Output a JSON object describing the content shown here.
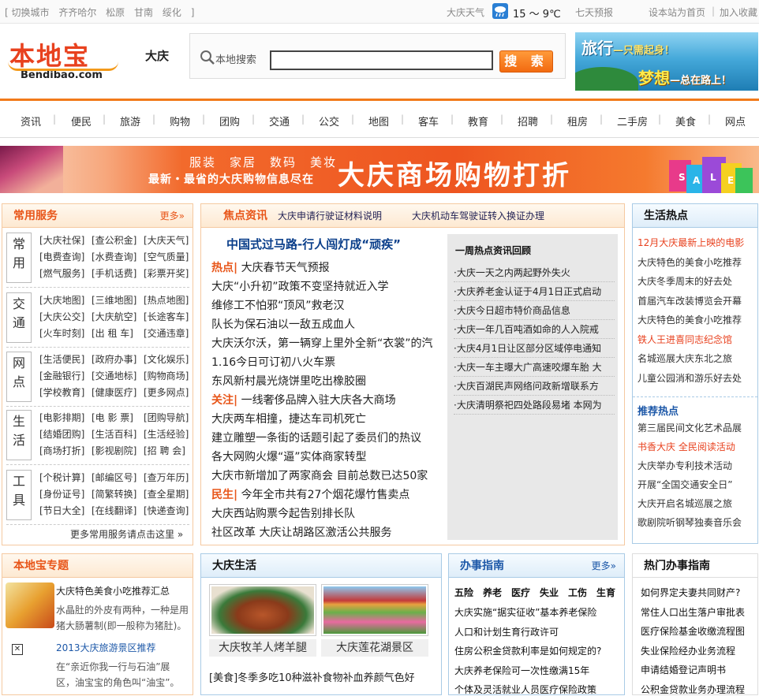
{
  "topbar": {
    "switch_city": "[ 切换城市",
    "cities": [
      "齐齐哈尔",
      "松原",
      "甘南",
      "绥化",
      "]"
    ],
    "weather_label": "大庆天气",
    "temp": "15 ～ 9℃",
    "forecast": "七天预报",
    "homepage": "设本站为首页",
    "sep": "|",
    "favorite": "加入收藏"
  },
  "header": {
    "logo_cn": "本地宝",
    "logo_en": "Bendibao.com",
    "city": "大庆",
    "search_label": "本地搜索",
    "search_value": "",
    "search_btn": "搜 索",
    "ad_line1": "旅行",
    "ad_line1b": "—只需起身！",
    "ad_line2": "梦想",
    "ad_line2b": "—总在路上！"
  },
  "nav": [
    "资讯",
    "便民",
    "旅游",
    "购物",
    "团购",
    "交通",
    "公交",
    "地图",
    "客车",
    "教育",
    "招聘",
    "租房",
    "二手房",
    "美食",
    "网点"
  ],
  "banner": {
    "line1": "服装　家居　数码　美妆",
    "line2": "最新・最省的大庆购物信息尽在",
    "title": "大庆商场购物打折"
  },
  "services": {
    "title": "常用服务",
    "more": "更多»",
    "groups": [
      {
        "cat": "常用",
        "links": [
          "[大庆社保]",
          "[查公积金]",
          "[大庆天气]",
          "[电费查询]",
          "[水费查询]",
          "[空气质量]",
          "[燃气服务]",
          "[手机话费]",
          "[彩票开奖]"
        ]
      },
      {
        "cat": "交通",
        "links": [
          "[大庆地图]",
          "[三维地图]",
          "[热点地图]",
          "[大庆公交]",
          "[大庆航空]",
          "[长途客车]",
          "[火车时刻]",
          "[出 租 车]",
          "[交通违章]"
        ]
      },
      {
        "cat": "网点",
        "links": [
          "[生活便民]",
          "[政府办事]",
          "[文化娱乐]",
          "[金融银行]",
          "[交通地标]",
          "[购物商场]",
          "[学校教育]",
          "[健康医疗]",
          "[更多网点]"
        ]
      },
      {
        "cat": "生活",
        "links": [
          "[电影排期]",
          "[电 影 票]",
          "[团购导航]",
          "[结婚团购]",
          "[生活百科]",
          "[生活经验]",
          "[商场打折]",
          "[影视剧院]",
          "[招 聘 会]"
        ]
      },
      {
        "cat": "工具",
        "links": [
          "[个税计算]",
          "[邮编区号]",
          "[查万年历]",
          "[身份证号]",
          "[简繁转换]",
          "[查全星期]",
          "[节日大全]",
          "[在线翻译]",
          "[快递查询]"
        ]
      }
    ],
    "footer": "更多常用服务请点击这里 »"
  },
  "focus": {
    "title": "焦点资讯",
    "headlines": [
      "大庆申请行驶证材料说明",
      "大庆机动车驾驶证转入换证办理"
    ],
    "top": "中国式过马路-行人闯灯成“顽疾”",
    "news": [
      {
        "tag": "热点|",
        "text": "大庆春节天气预报"
      },
      {
        "tag": "",
        "text": "大庆“小升初”政策不变坚持就近入学"
      },
      {
        "tag": "",
        "text": "维修工不怕邪“顶风”救老汉"
      },
      {
        "tag": "",
        "text": "队长为保石油以一敌五成血人"
      },
      {
        "tag": "",
        "text": "大庆沃尔沃，第一辆穿上里外全新“衣裳”的汽"
      },
      {
        "tag": "",
        "text": "1.16今日可订初八火车票"
      },
      {
        "tag": "",
        "text": "东风新村晨光烧饼里吃出橡胶圈"
      },
      {
        "tag": "关注|",
        "text": "一线奢侈品牌入驻大庆各大商场"
      },
      {
        "tag": "",
        "text": "大庆两车相撞，捷达车司机死亡"
      },
      {
        "tag": "",
        "text": "建立雕塑一条街的话题引起了委员们的热议"
      },
      {
        "tag": "",
        "text": "各大网购火爆“逼”实体商家转型"
      },
      {
        "tag": "",
        "text": "大庆市新增加了两家商会 目前总数已达50家"
      },
      {
        "tag": "民生|",
        "text": "今年全市共有27个烟花爆竹售卖点"
      },
      {
        "tag": "",
        "text": "大庆西站购票今起告别排长队"
      },
      {
        "tag": "",
        "text": "社区改革 大庆让胡路区激活公共服务"
      }
    ],
    "hot_title": "一周热点资讯回顾",
    "hot": [
      "·大庆一天之内两起野外失火",
      "·大庆养老金认证于4月1日正式启动",
      "·大庆今日超市特价商品信息",
      "·大庆一年几百吨酒如命的人入院戒",
      "·大庆4月1日让区部分区域停电通知",
      "·大庆一车主曝大广高速咬爆车胎 大",
      "·大庆百湖民声网络问政新增联系方",
      "·大庆清明祭祀四处路段易堵 本网为"
    ]
  },
  "life": {
    "title": "生活热点",
    "items": [
      {
        "text": "12月大庆最新上映的电影",
        "red": true
      },
      {
        "text": "大庆特色的美食小吃推荐",
        "red": false
      },
      {
        "text": "大庆冬季周末的好去处",
        "red": false
      },
      {
        "text": "首届汽车改装博览会开幕",
        "red": false
      },
      {
        "text": "大庆特色的美食小吃推荐",
        "red": false
      },
      {
        "text": "铁人王进喜同志纪念馆",
        "red": true
      },
      {
        "text": "名城巡展大庆东北之旅",
        "red": false
      },
      {
        "text": "儿童公园消和游乐好去处",
        "red": false
      }
    ],
    "sub": "推荐热点",
    "items2": [
      {
        "text": "第三届民间文化艺术品展",
        "red": false
      },
      {
        "text": "书香大庆 全民阅读活动",
        "red": true
      },
      {
        "text": "大庆举办专利技术活动",
        "red": false
      },
      {
        "text": "开展“全国交通安全日”",
        "red": false
      },
      {
        "text": "大庆开启名城巡展之旅",
        "red": false
      },
      {
        "text": "歌剧院听钢琴独奏音乐会",
        "red": false
      }
    ]
  },
  "topic": {
    "title": "本地宝专题",
    "item1_title": "大庆特色美食小吃推荐汇总",
    "item1_desc1": "水晶肚的外皮有两种，一种是用",
    "item1_desc2": "猪大肠薯制(即一般称为猪肚)。",
    "item2_title": "2013大庆旅游景区推荐",
    "item2_desc1": "在“亲近你我一行与石油”展",
    "item2_desc2": "区，油宝宝的角色叫“油宝”。"
  },
  "dqlife": {
    "title": "大庆生活",
    "cap1": "大庆牧羊人烤羊腿",
    "cap2": "大庆莲花湖景区",
    "link": "[美食]冬季多吃10种滋补食物补血养颜气色好"
  },
  "guide": {
    "title": "办事指南",
    "more": "更多»",
    "cats": "五险　养老　医疗　失业　工伤　生育",
    "items": [
      "大庆实施“据实征收”基本养老保险",
      "人口和计划生育行政许可",
      "住房公积金贷款利率是如何规定的?",
      "大庆养老保险可一次性缴满15年",
      "个体及灵活就业人员医疗保险政策"
    ]
  },
  "hotguide": {
    "title": "热门办事指南",
    "items": [
      "如何界定夫妻共同财产?",
      "常住人口出生落户审批表",
      "医疗保险基金收缴流程图",
      "失业保险经办业务流程",
      "申请结婚登记声明书",
      "公积金贷款业务办理流程"
    ]
  }
}
